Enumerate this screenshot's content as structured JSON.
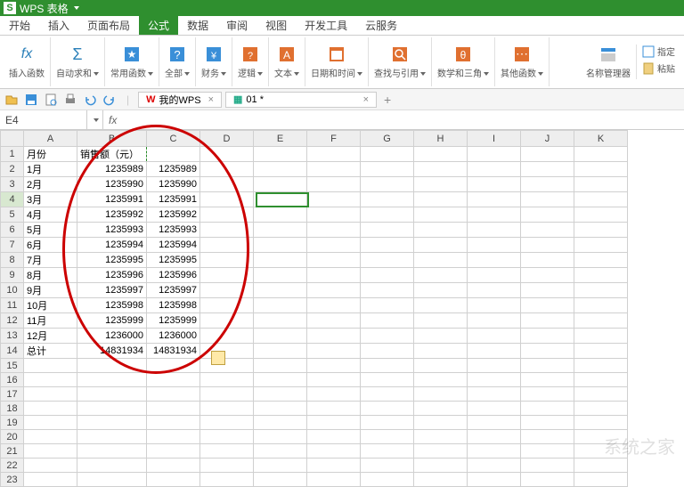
{
  "app": {
    "title": "WPS 表格"
  },
  "menu": {
    "tabs": [
      "开始",
      "插入",
      "页面布局",
      "公式",
      "数据",
      "审阅",
      "视图",
      "开发工具",
      "云服务"
    ],
    "active_index": 3
  },
  "ribbon": {
    "insert_fn": "插入函数",
    "autosum": "自动求和",
    "common": "常用函数",
    "all": "全部",
    "finance": "财务",
    "logic": "逻辑",
    "text": "文本",
    "datetime": "日期和时间",
    "lookup": "查找与引用",
    "math": "数学和三角",
    "other": "其他函数",
    "name_mgr": "名称管理器",
    "paste": "粘贴",
    "specify": "指定"
  },
  "doc_tabs": {
    "tab1": "我的WPS",
    "tab2": "01 *"
  },
  "namebox": {
    "cell": "E4"
  },
  "columns": [
    "A",
    "B",
    "C",
    "D",
    "E",
    "F",
    "G",
    "H",
    "I",
    "J",
    "K"
  ],
  "headers": {
    "colA": "月份",
    "colB": "销售额（元）"
  },
  "rows": [
    {
      "a": "1月",
      "b": 1235989,
      "c": 1235989
    },
    {
      "a": "2月",
      "b": 1235990,
      "c": 1235990
    },
    {
      "a": "3月",
      "b": 1235991,
      "c": 1235991
    },
    {
      "a": "4月",
      "b": 1235992,
      "c": 1235992
    },
    {
      "a": "5月",
      "b": 1235993,
      "c": 1235993
    },
    {
      "a": "6月",
      "b": 1235994,
      "c": 1235994
    },
    {
      "a": "7月",
      "b": 1235995,
      "c": 1235995
    },
    {
      "a": "8月",
      "b": 1235996,
      "c": 1235996
    },
    {
      "a": "9月",
      "b": 1235997,
      "c": 1235997
    },
    {
      "a": "10月",
      "b": 1235998,
      "c": 1235998
    },
    {
      "a": "11月",
      "b": 1235999,
      "c": 1235999
    },
    {
      "a": "12月",
      "b": 1236000,
      "c": 1236000
    }
  ],
  "total": {
    "label": "总计",
    "b": 14831934,
    "c": 14831934
  },
  "fx_symbol": "fx",
  "sigma": "Σ"
}
